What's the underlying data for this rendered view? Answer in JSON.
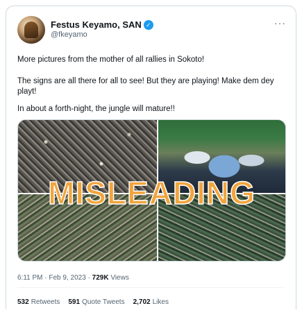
{
  "author": {
    "name": "Festus Keyamo, SAN",
    "handle": "@fkeyamo",
    "verified_icon": "verified-badge-icon"
  },
  "tweet": {
    "paragraphs": [
      "More pictures from the mother of all rallies in Sokoto!",
      "The signs are all there for all to see! But they are playing! Make dem dey playt!",
      "In about a forth-night, the jungle will mature!!"
    ]
  },
  "media": {
    "overlay_text": "MISLEADING"
  },
  "meta": {
    "time": "6:11 PM",
    "date": "Feb 9, 2023",
    "views_count": "729K",
    "views_label": "Views"
  },
  "stats": {
    "retweets_count": "532",
    "retweets_label": "Retweets",
    "quotes_count": "591",
    "quotes_label": "Quote Tweets",
    "likes_count": "2,702",
    "likes_label": "Likes"
  },
  "more_icon": "more-horizontal-icon",
  "colors": {
    "verified": "#1d9bf0",
    "overlay": "#f2a43c",
    "secondary_text": "#536471"
  }
}
